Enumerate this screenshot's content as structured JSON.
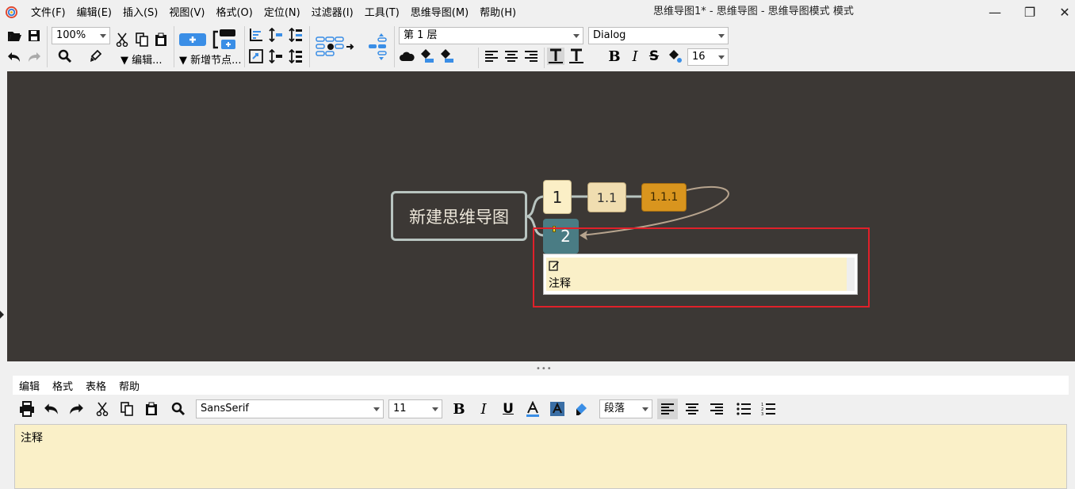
{
  "window": {
    "title": "思维导图1* - 思维导图 - 思维导图模式 模式",
    "minimize": "—",
    "maximize": "❐",
    "close": "✕"
  },
  "menu": [
    "文件(F)",
    "编辑(E)",
    "插入(S)",
    "视图(V)",
    "格式(O)",
    "定位(N)",
    "过滤器(I)",
    "工具(T)",
    "思维导图(M)",
    "帮助(H)"
  ],
  "toolbar": {
    "zoom": "100%",
    "edit_dropdown": "▼ 编辑...",
    "new_node_dropdown": "▼ 新增节点...",
    "level": "第 1 层",
    "font": "Dialog",
    "font_size": "16"
  },
  "mindmap": {
    "root": "新建思维导图",
    "node_1": "1",
    "node_1_1": "1.1",
    "node_1_1_1": "1.1.1",
    "node_2": "2",
    "note_popup": "注释"
  },
  "note_editor": {
    "menu": [
      "编辑",
      "格式",
      "表格",
      "帮助"
    ],
    "font": "SansSerif",
    "size": "11",
    "paragraph": "段落",
    "content": "注释"
  },
  "colors": {
    "canvas_bg": "#3c3835",
    "root_border": "#b8c4c0",
    "node_1_bg": "#fbefc6",
    "node_1_1_bg": "#f0ddb0",
    "node_1_1_1_bg": "#d9951e",
    "node_2_bg": "#4a7c84",
    "selection": "#e0202a",
    "note_bg": "#faf0c8"
  }
}
